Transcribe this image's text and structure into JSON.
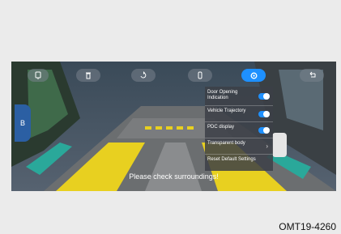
{
  "toolbar": {
    "buttons": [
      {
        "name": "camera-front-button",
        "icon": "camera-icon"
      },
      {
        "name": "trash-button",
        "icon": "trash-icon"
      },
      {
        "name": "view-rotate-button",
        "icon": "rotate-icon"
      },
      {
        "name": "car-top-view-button",
        "icon": "car-icon"
      },
      {
        "name": "settings-button",
        "icon": "gear-icon",
        "active": true
      },
      {
        "name": "back-button",
        "icon": "return-icon"
      }
    ]
  },
  "side_tab": {
    "label": "B"
  },
  "settings_menu": {
    "items": [
      {
        "label": "Door Opening Indication",
        "control": "toggle",
        "on": true
      },
      {
        "label": "Vehicle Trajectory",
        "control": "toggle",
        "on": true
      },
      {
        "label": "PDC display",
        "control": "toggle",
        "on": true
      },
      {
        "label": "Transparent body",
        "control": "chevron"
      },
      {
        "label": "Reset Default Settings",
        "control": "none"
      }
    ]
  },
  "camera_view": {
    "message": "Please check surroundings!"
  },
  "figure_code": "OMT19-4260",
  "colors": {
    "accent": "#1e90ff",
    "lane": "#e8d020"
  }
}
